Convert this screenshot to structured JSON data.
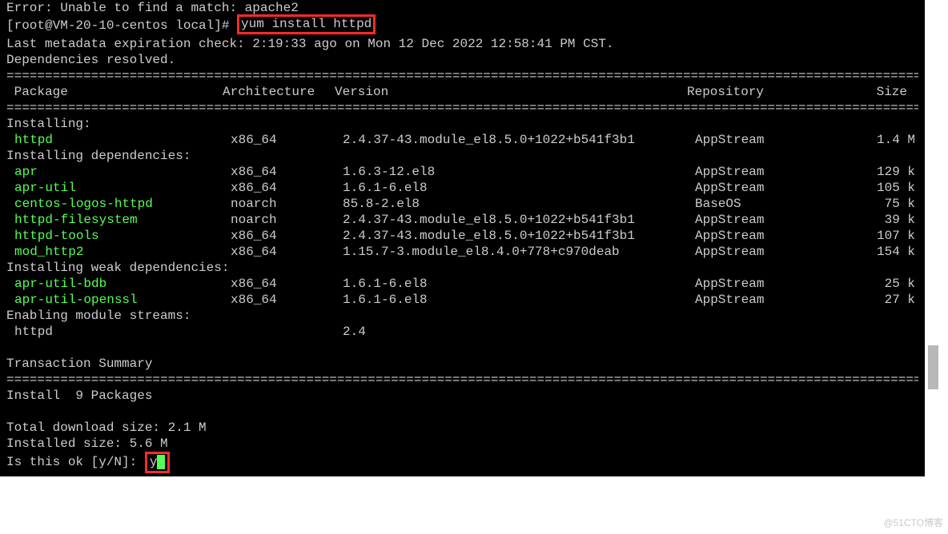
{
  "top_error": "Error: Unable to find a match: apache2",
  "prompt": "[root@VM-20-10-centos local]# ",
  "command": "yum install httpd",
  "meta_line": "Last metadata expiration check: 2:19:33 ago on Mon 12 Dec 2022 12:58:41 PM CST.",
  "dep_resolved": "Dependencies resolved.",
  "sep": "===============================================================================================================================",
  "headers": {
    "pkg": " Package",
    "arch": "Architecture",
    "ver": "Version",
    "repo": "Repository",
    "size": "Size"
  },
  "sections": {
    "installing": "Installing:",
    "deps": "Installing dependencies:",
    "weak": "Installing weak dependencies:",
    "module": "Enabling module streams:"
  },
  "packages": {
    "main": [
      {
        "name": "httpd",
        "arch": "x86_64",
        "ver": "2.4.37-43.module_el8.5.0+1022+b541f3b1",
        "repo": "AppStream",
        "size": "1.4 M"
      }
    ],
    "deps": [
      {
        "name": "apr",
        "arch": "x86_64",
        "ver": "1.6.3-12.el8",
        "repo": "AppStream",
        "size": "129 k"
      },
      {
        "name": "apr-util",
        "arch": "x86_64",
        "ver": "1.6.1-6.el8",
        "repo": "AppStream",
        "size": "105 k"
      },
      {
        "name": "centos-logos-httpd",
        "arch": "noarch",
        "ver": "85.8-2.el8",
        "repo": "BaseOS",
        "size": "75 k"
      },
      {
        "name": "httpd-filesystem",
        "arch": "noarch",
        "ver": "2.4.37-43.module_el8.5.0+1022+b541f3b1",
        "repo": "AppStream",
        "size": "39 k"
      },
      {
        "name": "httpd-tools",
        "arch": "x86_64",
        "ver": "2.4.37-43.module_el8.5.0+1022+b541f3b1",
        "repo": "AppStream",
        "size": "107 k"
      },
      {
        "name": "mod_http2",
        "arch": "x86_64",
        "ver": "1.15.7-3.module_el8.4.0+778+c970deab",
        "repo": "AppStream",
        "size": "154 k"
      }
    ],
    "weak": [
      {
        "name": "apr-util-bdb",
        "arch": "x86_64",
        "ver": "1.6.1-6.el8",
        "repo": "AppStream",
        "size": "25 k"
      },
      {
        "name": "apr-util-openssl",
        "arch": "x86_64",
        "ver": "1.6.1-6.el8",
        "repo": "AppStream",
        "size": "27 k"
      }
    ],
    "module": [
      {
        "name": "httpd",
        "arch": "",
        "ver": "2.4",
        "repo": "",
        "size": ""
      }
    ]
  },
  "summary_hdr": "Transaction Summary",
  "install_count": "Install  9 Packages",
  "dl_size": "Total download size: 2.1 M",
  "inst_size": "Installed size: 5.6 M",
  "confirm": "Is this ok [y/N]: ",
  "confirm_input": "y",
  "watermark": "@51CTO博客"
}
